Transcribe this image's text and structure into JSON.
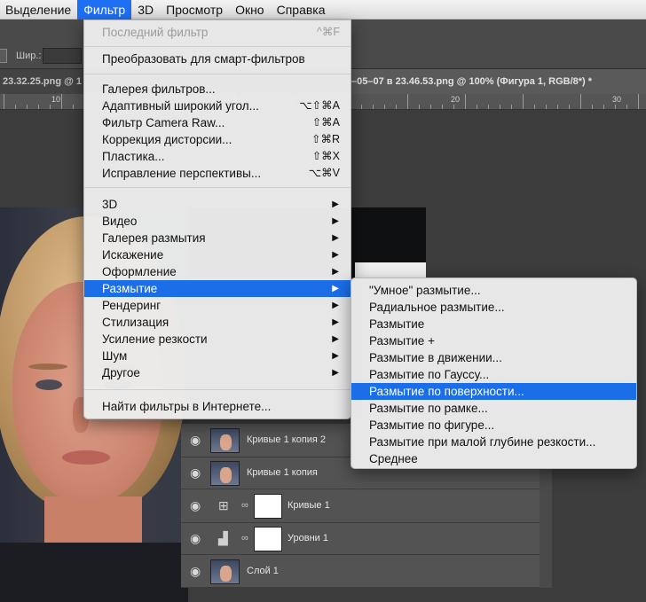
{
  "menubar": {
    "items": [
      {
        "label": "Выделение",
        "active": false
      },
      {
        "label": "Фильтр",
        "active": true
      },
      {
        "label": "3D",
        "active": false
      },
      {
        "label": "Просмотр",
        "active": false
      },
      {
        "label": "Окно",
        "active": false
      },
      {
        "label": "Справка",
        "active": false
      }
    ]
  },
  "options_bar": {
    "width_label": "Шир.:"
  },
  "tabs": {
    "left": "23.32.25.png @ 1",
    "right": "–05–07 в 23.46.53.png @ 100% (Фигура 1, RGB/8*) *"
  },
  "ruler": {
    "labels": [
      "10",
      "20",
      "30"
    ]
  },
  "filter_menu": {
    "last_filter": {
      "label": "Последний фильтр",
      "shortcut": "^⌘F"
    },
    "smart": "Преобразовать для смарт-фильтров",
    "group1": [
      {
        "label": "Галерея фильтров...",
        "shortcut": ""
      },
      {
        "label": "Адаптивный широкий угол...",
        "shortcut": "⌥⇧⌘A"
      },
      {
        "label": "Фильтр Camera Raw...",
        "shortcut": "⇧⌘A"
      },
      {
        "label": "Коррекция дисторсии...",
        "shortcut": "⇧⌘R"
      },
      {
        "label": "Пластика...",
        "shortcut": "⇧⌘X"
      },
      {
        "label": "Исправление перспективы...",
        "shortcut": "⌥⌘V"
      }
    ],
    "submenus": [
      {
        "label": "3D",
        "highlighted": false
      },
      {
        "label": "Видео",
        "highlighted": false
      },
      {
        "label": "Галерея размытия",
        "highlighted": false
      },
      {
        "label": "Искажение",
        "highlighted": false
      },
      {
        "label": "Оформление",
        "highlighted": false
      },
      {
        "label": "Размытие",
        "highlighted": true
      },
      {
        "label": "Рендеринг",
        "highlighted": false
      },
      {
        "label": "Стилизация",
        "highlighted": false
      },
      {
        "label": "Усиление резкости",
        "highlighted": false
      },
      {
        "label": "Шум",
        "highlighted": false
      },
      {
        "label": "Другое",
        "highlighted": false
      }
    ],
    "online": "Найти фильтры в Интернете...",
    "arrow": "▶"
  },
  "blur_submenu": {
    "items": [
      {
        "label": "\"Умное\" размытие...",
        "highlighted": false
      },
      {
        "label": "Радиальное размытие...",
        "highlighted": false
      },
      {
        "label": "Размытие",
        "highlighted": false
      },
      {
        "label": "Размытие +",
        "highlighted": false
      },
      {
        "label": "Размытие в движении...",
        "highlighted": false
      },
      {
        "label": "Размытие по Гауссу...",
        "highlighted": false
      },
      {
        "label": "Размытие по поверхности...",
        "highlighted": true
      },
      {
        "label": "Размытие по рамке...",
        "highlighted": false
      },
      {
        "label": "Размытие по фигуре...",
        "highlighted": false
      },
      {
        "label": "Размытие при малой глубине резкости...",
        "highlighted": false
      },
      {
        "label": "Среднее",
        "highlighted": false
      }
    ]
  },
  "layers": [
    {
      "name": "Кривые 1 копия 2",
      "kind": "photo"
    },
    {
      "name": "Кривые 1 копия",
      "kind": "photo"
    },
    {
      "name": "Кривые 1",
      "kind": "curves"
    },
    {
      "name": "Уровни 1",
      "kind": "levels"
    },
    {
      "name": "Слой 1",
      "kind": "photo"
    }
  ],
  "colors": {
    "accent": "#1b6de8",
    "menu_bg": "#ececec"
  }
}
